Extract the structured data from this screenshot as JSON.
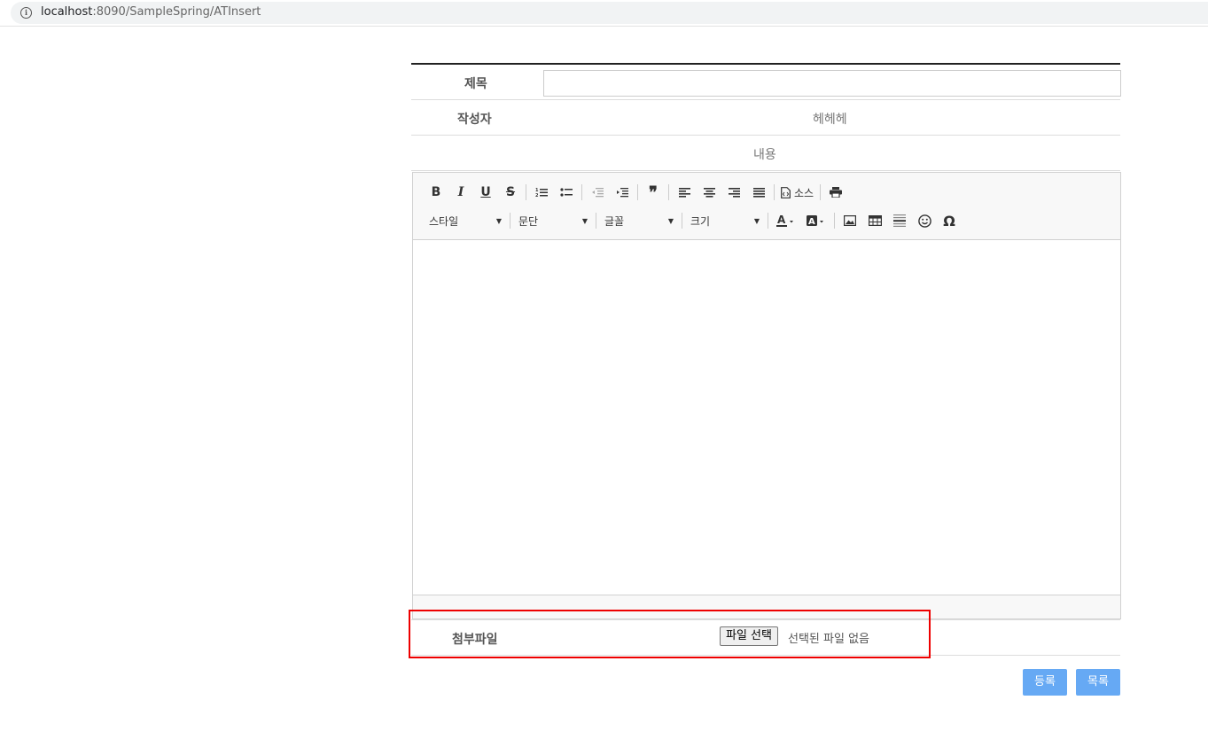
{
  "browser": {
    "url_host": "localhost",
    "url_rest": ":8090/SampleSpring/ATInsert"
  },
  "form": {
    "title_label": "제목",
    "title_value": "",
    "author_label": "작성자",
    "author_value": "헤헤헤",
    "content_label": "내용",
    "attachment_label": "첨부파일",
    "file_button_label": "파일 선택",
    "file_status": "선택된 파일 없음"
  },
  "editor": {
    "row1": [
      "bold-icon",
      "italic-icon",
      "underline-icon",
      "strikethrough-icon",
      "numbered-list-icon",
      "bulleted-list-icon",
      "outdent-icon",
      "indent-icon",
      "blockquote-icon",
      "align-left-icon",
      "align-center-icon",
      "align-right-icon",
      "justify-icon",
      "source-icon",
      "print-icon"
    ],
    "source_label": "소스",
    "combos": {
      "style": "스타일",
      "format": "문단",
      "font": "글꼴",
      "size": "크기"
    }
  },
  "actions": {
    "submit_label": "등록",
    "list_label": "목록"
  },
  "colors": {
    "button": "#66a9f4",
    "highlight": "#ee0000"
  }
}
